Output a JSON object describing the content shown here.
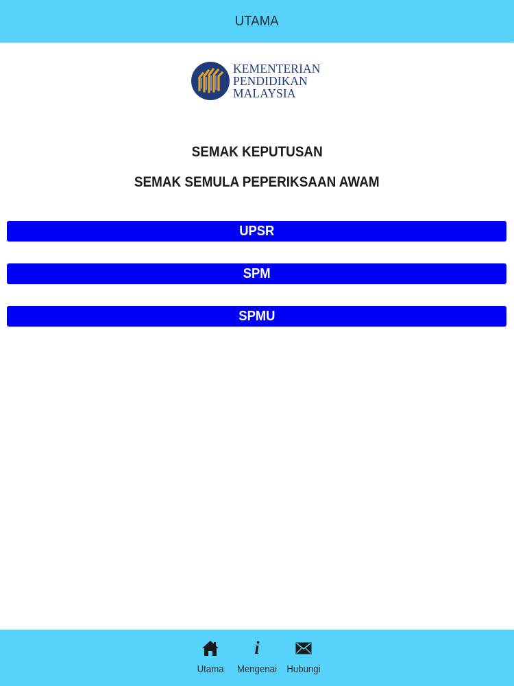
{
  "header": {
    "title": "UTAMA"
  },
  "logo": {
    "line1": "KEMENTERIAN",
    "line2": "PENDIDIKAN",
    "line3": "MALAYSIA"
  },
  "main": {
    "heading1": "SEMAK KEPUTUSAN",
    "heading2": "SEMAK SEMULA PEPERIKSAAN AWAM",
    "buttons": [
      {
        "label": "UPSR"
      },
      {
        "label": "SPM"
      },
      {
        "label": "SPMU"
      }
    ]
  },
  "bottom_nav": {
    "items": [
      {
        "label": "Utama",
        "icon": "home-icon"
      },
      {
        "label": "Mengenai",
        "icon": "info-icon"
      },
      {
        "label": "Hubungi",
        "icon": "mail-icon"
      }
    ]
  },
  "colors": {
    "bar": "#57d2fb",
    "button": "#0000f5",
    "logo_blue": "#1f3b79",
    "logo_gold": "#e2a42a"
  }
}
